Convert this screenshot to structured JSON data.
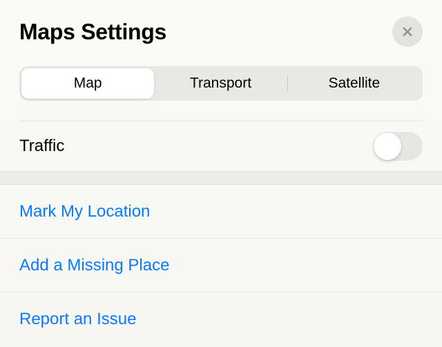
{
  "header": {
    "title": "Maps Settings"
  },
  "segmented": {
    "map": "Map",
    "transport": "Transport",
    "satellite": "Satellite",
    "selected": "map"
  },
  "traffic": {
    "label": "Traffic",
    "enabled": false
  },
  "actions": {
    "mark_location": "Mark My Location",
    "add_missing_place": "Add a Missing Place",
    "report_issue": "Report an Issue"
  }
}
